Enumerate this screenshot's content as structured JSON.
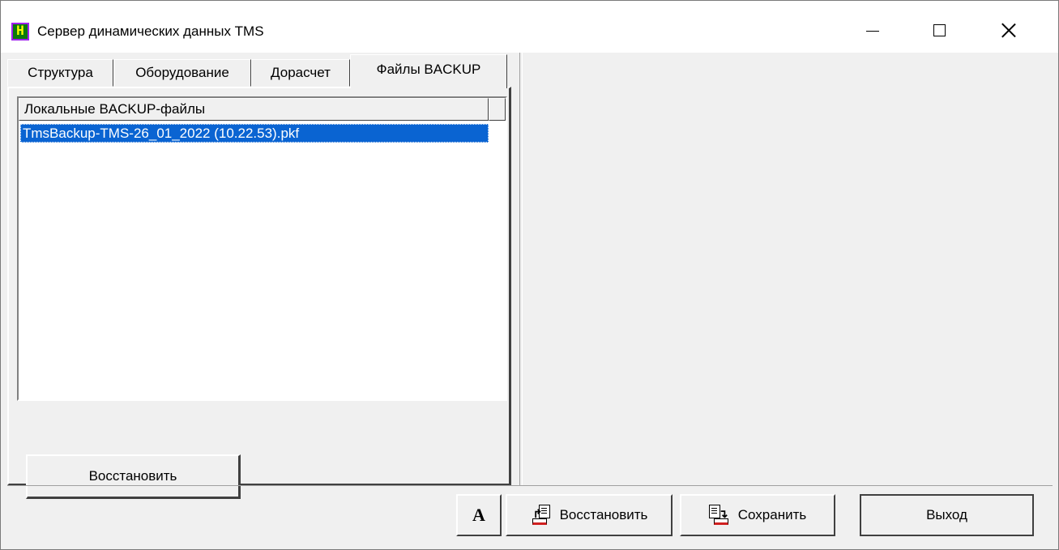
{
  "window": {
    "title": "Сервер динамических данных TMS",
    "app_icon_glyph": "H"
  },
  "tabs": [
    {
      "label": "Структура",
      "selected": false
    },
    {
      "label": "Оборудование",
      "selected": false
    },
    {
      "label": "Дорасчет",
      "selected": false
    },
    {
      "label": "Файлы BACKUP",
      "selected": true
    }
  ],
  "backup_list": {
    "column_header": "Локальные BACKUP-файлы",
    "items": [
      "TmsBackup-TMS-26_01_2022 (10.22.53).pkf"
    ],
    "selected_index": 0
  },
  "panel": {
    "restore_local_label": "Восстановить"
  },
  "toolbar": {
    "font_label": "A",
    "restore_label": "Восстановить",
    "save_label": "Сохранить",
    "exit_label": "Выход"
  },
  "colors": {
    "selection": "#0a64d2",
    "background": "#f0f0f0",
    "titlebar": "#ffffff"
  }
}
